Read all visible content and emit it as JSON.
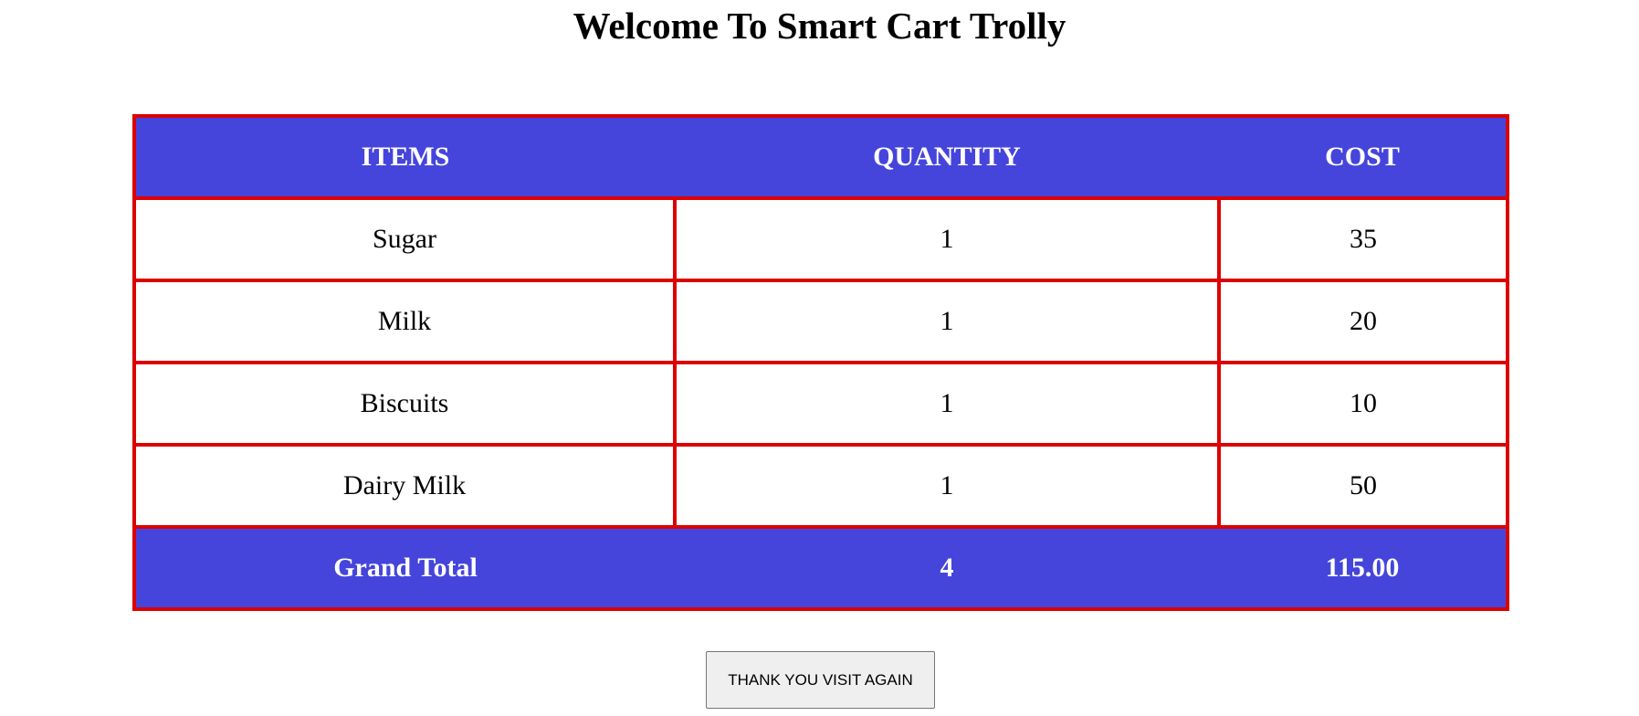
{
  "page": {
    "title": "Welcome To Smart Cart Trolly"
  },
  "table": {
    "headers": {
      "items": "ITEMS",
      "quantity": "QUANTITY",
      "cost": "COST"
    },
    "rows": [
      {
        "item": "Sugar",
        "quantity": "1",
        "cost": "35"
      },
      {
        "item": "Milk",
        "quantity": "1",
        "cost": "20"
      },
      {
        "item": "Biscuits",
        "quantity": "1",
        "cost": "10"
      },
      {
        "item": "Dairy Milk",
        "quantity": "1",
        "cost": "50"
      }
    ],
    "footer": {
      "label": "Grand Total",
      "quantity": "4",
      "cost": "115.00"
    }
  },
  "actions": {
    "thanks_label": "THANK YOU VISIT AGAIN"
  },
  "colors": {
    "header_bg": "#4545dc",
    "border": "#dd0000"
  }
}
